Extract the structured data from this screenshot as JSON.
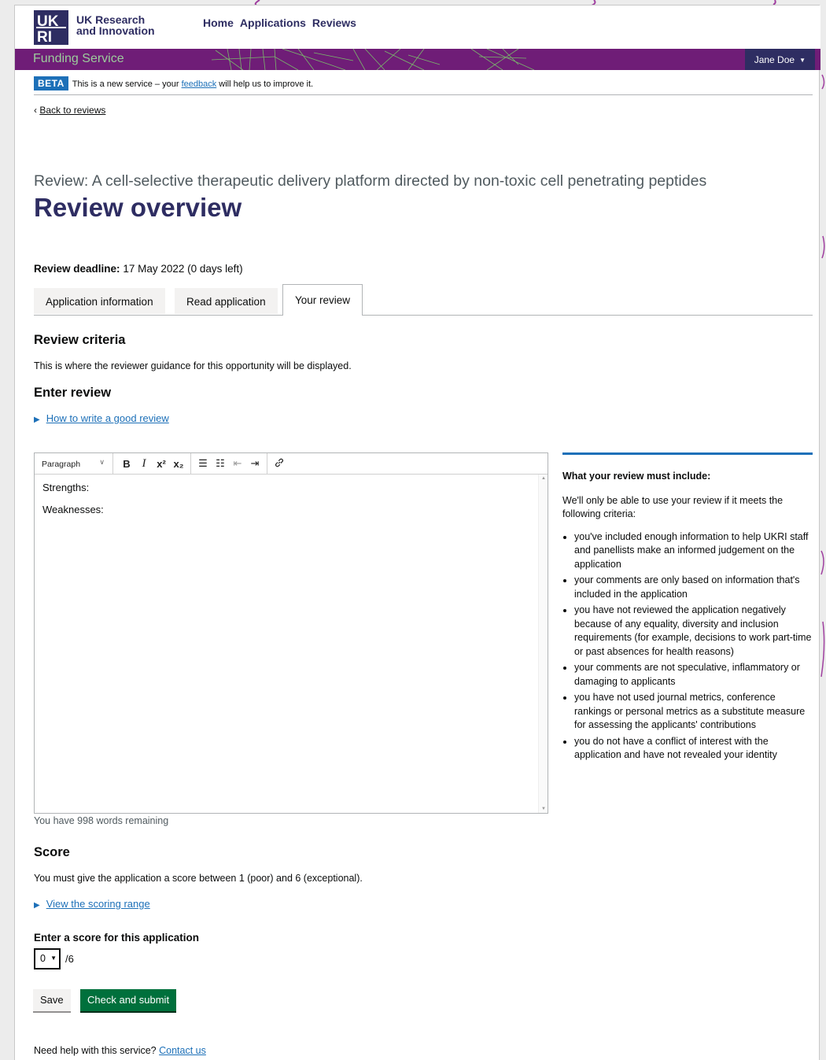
{
  "header": {
    "logo_text": "UKRI",
    "brand_line1": "UK Research",
    "brand_line2": "and Innovation",
    "nav": [
      "Home",
      "Applications",
      "Reviews"
    ],
    "service_name": "Funding Service",
    "user": "Jane Doe"
  },
  "beta": {
    "tag": "BETA",
    "text_before": "This is a new service – your",
    "link": "feedback",
    "text_after": "will help us to improve it."
  },
  "back_link": "Back to reviews",
  "caption": "Review: A cell-selective therapeutic delivery platform directed by non-toxic cell penetrating peptides",
  "page_title": "Review overview",
  "deadline": {
    "label": "Review deadline:",
    "value": "17 May 2022 (0 days left)"
  },
  "tabs": [
    {
      "label": "Application information",
      "active": false
    },
    {
      "label": "Read application",
      "active": false
    },
    {
      "label": "Your review",
      "active": true
    }
  ],
  "criteria": {
    "heading": "Review criteria",
    "text": "This is where the reviewer guidance for this opportunity will be displayed."
  },
  "enter_review": {
    "heading": "Enter review",
    "details_link": "How to write a good review"
  },
  "editor": {
    "format_select": "Paragraph",
    "toolbar_icons": [
      "bold-icon",
      "italic-icon",
      "superscript-icon",
      "subscript-icon",
      "bullet-list-icon",
      "numbered-list-icon",
      "outdent-icon",
      "indent-icon",
      "link-icon"
    ],
    "toolbar_glyphs": {
      "bold": "B",
      "italic": "I",
      "sup": "x²",
      "sub": "x₂",
      "bullets": "☰",
      "numbers": "☷",
      "outdent": "⇤",
      "indent": "⇥",
      "link": "🔗"
    },
    "content": [
      "Strengths:",
      "Weaknesses:"
    ],
    "words_remaining": "You have 998 words remaining"
  },
  "sidebar": {
    "heading": "What your review must include:",
    "intro": "We'll only be able to use your review if it meets the following criteria:",
    "items": [
      "you've included enough information to help UKRI staff and panellists make an informed judgement on the application",
      "your comments are only based on information that's included in the application",
      "you have not reviewed the application negatively because of any equality, diversity and inclusion requirements (for example, decisions to work part-time or past absences for health reasons)",
      "your comments are not speculative, inflammatory or damaging to applicants",
      "you have not used journal metrics, conference rankings or personal metrics as a substitute measure for assessing the applicants' contributions",
      "you do not have a conflict of interest with the application and have not revealed your identity"
    ]
  },
  "score": {
    "heading": "Score",
    "text": "You must give the application a score between 1 (poor) and 6 (exceptional).",
    "details_link": "View the scoring range",
    "label": "Enter a score for this application",
    "value": "0",
    "out_of": "/6"
  },
  "buttons": {
    "save": "Save",
    "submit": "Check and submit"
  },
  "help": {
    "text": "Need help with this service?",
    "link": "Contact us"
  },
  "colors": {
    "brand_navy": "#2e2d62",
    "purple_bar": "#6f1d77",
    "link_blue": "#1d70b8",
    "submit_green": "#00703c"
  }
}
